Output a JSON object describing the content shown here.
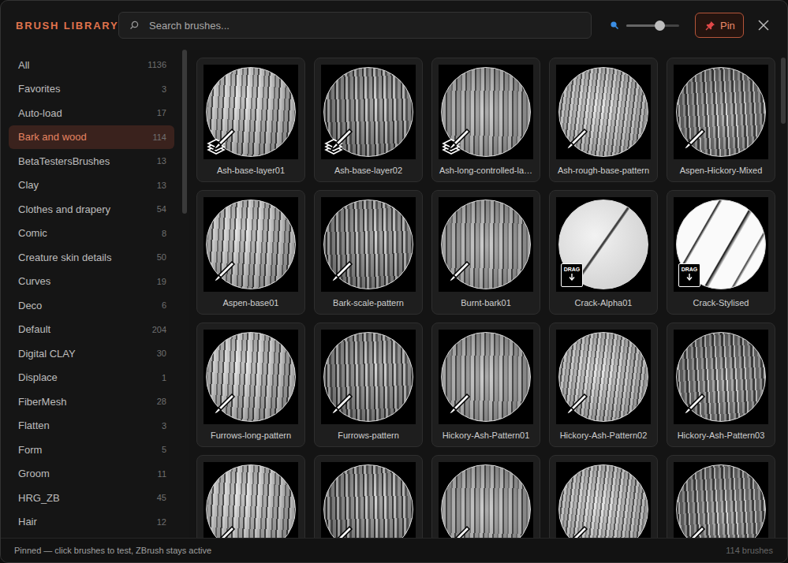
{
  "window": {
    "title": "BRUSH LIBRARY"
  },
  "search": {
    "placeholder": "Search brushes..."
  },
  "zoom": {
    "level": 0.63
  },
  "pin_button": {
    "label": "Pin",
    "on": true
  },
  "sidebar": {
    "items": [
      {
        "label": "All",
        "count": "1136",
        "selected": false
      },
      {
        "label": "Favorites",
        "count": "3",
        "selected": false
      },
      {
        "label": "Auto-load",
        "count": "17",
        "selected": false
      },
      {
        "label": "Bark and wood",
        "count": "114",
        "selected": true
      },
      {
        "label": "BetaTestersBrushes",
        "count": "13",
        "selected": false
      },
      {
        "label": "Clay",
        "count": "13",
        "selected": false
      },
      {
        "label": "Clothes and drapery",
        "count": "54",
        "selected": false
      },
      {
        "label": "Comic",
        "count": "8",
        "selected": false
      },
      {
        "label": "Creature skin details",
        "count": "50",
        "selected": false
      },
      {
        "label": "Curves",
        "count": "19",
        "selected": false
      },
      {
        "label": "Deco",
        "count": "6",
        "selected": false
      },
      {
        "label": "Default",
        "count": "204",
        "selected": false
      },
      {
        "label": "Digital CLAY",
        "count": "30",
        "selected": false
      },
      {
        "label": "Displace",
        "count": "1",
        "selected": false
      },
      {
        "label": "FiberMesh",
        "count": "28",
        "selected": false
      },
      {
        "label": "Flatten",
        "count": "3",
        "selected": false
      },
      {
        "label": "Form",
        "count": "5",
        "selected": false
      },
      {
        "label": "Groom",
        "count": "11",
        "selected": false
      },
      {
        "label": "HRG_ZB",
        "count": "45",
        "selected": false
      },
      {
        "label": "Hair",
        "count": "12",
        "selected": false
      }
    ]
  },
  "brushes": [
    {
      "name": "Ash-base-layer01",
      "kind": "layers"
    },
    {
      "name": "Ash-base-layer02",
      "kind": "layers"
    },
    {
      "name": "Ash-long-controlled-la…",
      "kind": "layers"
    },
    {
      "name": "Ash-rough-base-pattern",
      "kind": "brush"
    },
    {
      "name": "Aspen-Hickory-Mixed",
      "kind": "brush"
    },
    {
      "name": "Aspen-base01",
      "kind": "brush"
    },
    {
      "name": "Bark-scale-pattern",
      "kind": "brush"
    },
    {
      "name": "Burnt-bark01",
      "kind": "brush"
    },
    {
      "name": "Crack-Alpha01",
      "kind": "drag",
      "badge": "DRAG"
    },
    {
      "name": "Crack-Stylised",
      "kind": "drag",
      "badge": "DRAG"
    },
    {
      "name": "Furrows-long-pattern",
      "kind": "brush"
    },
    {
      "name": "Furrows-pattern",
      "kind": "brush"
    },
    {
      "name": "Hickory-Ash-Pattern01",
      "kind": "brush"
    },
    {
      "name": "Hickory-Ash-Pattern02",
      "kind": "brush"
    },
    {
      "name": "Hickory-Ash-Pattern03",
      "kind": "brush"
    },
    {
      "kind": "brush"
    },
    {
      "kind": "brush"
    },
    {
      "kind": "brush"
    },
    {
      "kind": "brush"
    },
    {
      "kind": "brush"
    }
  ],
  "status_bar": {
    "message": "Pinned — click brushes to test, ZBrush stays active",
    "count": "114 brushes"
  }
}
